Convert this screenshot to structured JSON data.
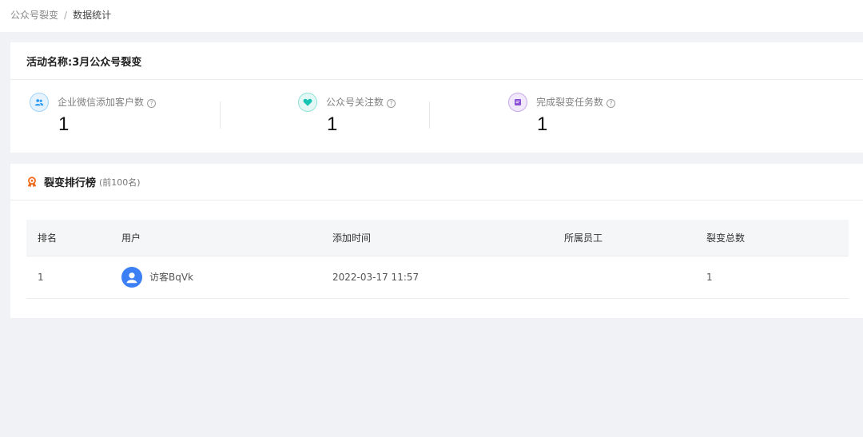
{
  "breadcrumb": {
    "parent": "公众号裂变",
    "separator": "/",
    "current": "数据统计"
  },
  "activity": {
    "title": "活动名称:3月公众号裂变"
  },
  "stats": [
    {
      "label": "企业微信添加客户数",
      "value": "1",
      "icon": "people-icon",
      "color": "#2d9bf0"
    },
    {
      "label": "公众号关注数",
      "value": "1",
      "icon": "heart-icon",
      "color": "#17c3b2"
    },
    {
      "label": "完成裂变任务数",
      "value": "1",
      "icon": "task-icon",
      "color": "#8a4fd6"
    }
  ],
  "ranking": {
    "title": "裂变排行榜",
    "subtitle": "(前100名)",
    "columns": [
      "排名",
      "用户",
      "添加时间",
      "所属员工",
      "裂变总数"
    ],
    "rows": [
      {
        "rank": "1",
        "user": "访客BqVk",
        "added_time": "2022-03-17 11:57",
        "staff": "",
        "total": "1"
      }
    ]
  },
  "colors": {
    "accent": "#3d7ff5",
    "rank_icon": "#f06a1d",
    "background": "#f0f2f5"
  }
}
